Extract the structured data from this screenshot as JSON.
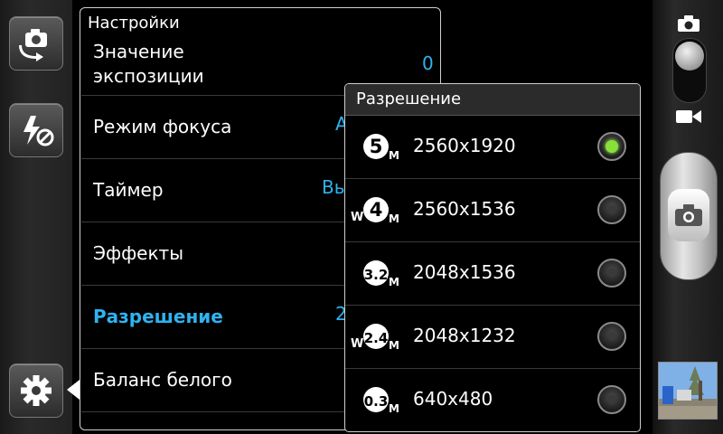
{
  "settings": {
    "title": "Настройки",
    "items": [
      {
        "label": "Значение\nэкспозиции",
        "value": "0"
      },
      {
        "label": "Режим фокуса",
        "value": "А"
      },
      {
        "label": "Таймер",
        "value": "Вы"
      },
      {
        "label": "Эффекты",
        "value": ""
      },
      {
        "label": "Разрешение",
        "value": "2"
      },
      {
        "label": "Баланс белого",
        "value": ""
      }
    ]
  },
  "resolution_dialog": {
    "title": "Разрешение",
    "options": [
      {
        "badge": "5",
        "wide": false,
        "label": "2560x1920",
        "selected": true
      },
      {
        "badge": "4",
        "wide": true,
        "label": "2560x1536",
        "selected": false
      },
      {
        "badge": "3.2",
        "wide": false,
        "label": "2048x1536",
        "selected": false
      },
      {
        "badge": "2.4",
        "wide": true,
        "label": "2048x1232",
        "selected": false
      },
      {
        "badge": "0.3",
        "wide": false,
        "label": "640x480",
        "selected": false
      }
    ],
    "badge_suffix": "M",
    "wide_prefix": "W"
  },
  "icons": {
    "switch_camera": "switch-camera-icon",
    "flash_off": "flash-off-icon",
    "settings": "gear-icon",
    "photo_mode": "camera-icon",
    "video_mode": "video-camera-icon",
    "shutter": "shutter-camera-icon"
  },
  "colors": {
    "accent": "#2fb2f0",
    "selected_radio": "#86e23a"
  }
}
